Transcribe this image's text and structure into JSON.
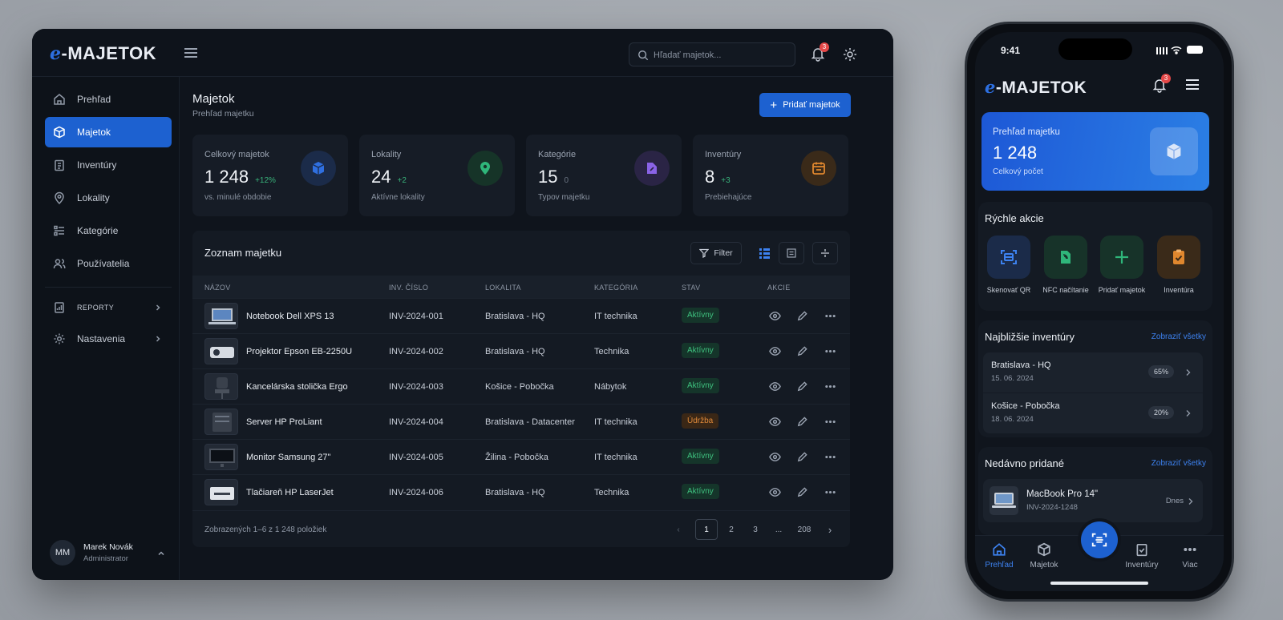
{
  "app": {
    "logo_e": "e",
    "logo_text": "-MAJETOK"
  },
  "header": {
    "search_placeholder": "Hľadať majetok...",
    "notif_count": "3"
  },
  "sidebar": {
    "items": [
      {
        "label": "Prehľad",
        "icon": "home-icon"
      },
      {
        "label": "Majetok",
        "icon": "box-icon"
      },
      {
        "label": "Inventúry",
        "icon": "clipboard-icon"
      },
      {
        "label": "Lokality",
        "icon": "map-pin-icon"
      },
      {
        "label": "Kategórie",
        "icon": "list-icon"
      },
      {
        "label": "Používatelia",
        "icon": "users-icon"
      },
      {
        "label": "REPORTY",
        "icon": "report-icon"
      },
      {
        "label": "Nastavenia",
        "icon": "gear-icon"
      }
    ],
    "user": {
      "initials": "MM",
      "name": "Marek Novák",
      "role": "Administrator"
    }
  },
  "page": {
    "title": "Majetok",
    "subtitle": "Prehľad majetku",
    "add_button": "Pridať majetok"
  },
  "stats": [
    {
      "label": "Celkový majetok",
      "value": "1 248",
      "delta": "+12%",
      "sub": "vs. minulé obdobie",
      "icon": "box-icon",
      "color": "#2f6fe0"
    },
    {
      "label": "Lokality",
      "value": "24",
      "delta": "+2",
      "sub": "Aktívne lokality",
      "icon": "map-pin-icon",
      "color": "#2fb67a"
    },
    {
      "label": "Kategórie",
      "value": "15",
      "delta": "0",
      "sub": "Typov majetku",
      "icon": "tag-icon",
      "color": "#8a63e6"
    },
    {
      "label": "Inventúry",
      "value": "8",
      "delta": "+3",
      "sub": "Prebiehajúce",
      "icon": "calendar-icon",
      "color": "#e0872e"
    }
  ],
  "table": {
    "title": "Zoznam majetku",
    "filter_label": "Filter",
    "columns": [
      "NÁZOV",
      "INV. ČÍSLO",
      "LOKALITA",
      "KATEGÓRIA",
      "STAV",
      "AKCIE"
    ],
    "rows": [
      {
        "name": "Notebook Dell XPS 13",
        "inv": "INV-2024-001",
        "location": "Bratislava - HQ",
        "category": "IT technika",
        "status": "Aktívny",
        "status_type": "ok",
        "thumb": "laptop"
      },
      {
        "name": "Projektor Epson EB-2250U",
        "inv": "INV-2024-002",
        "location": "Bratislava - HQ",
        "category": "Technika",
        "status": "Aktívny",
        "status_type": "ok",
        "thumb": "projector"
      },
      {
        "name": "Kancelárska stolička Ergo",
        "inv": "INV-2024-003",
        "location": "Košice - Pobočka",
        "category": "Nábytok",
        "status": "Aktívny",
        "status_type": "ok",
        "thumb": "chair"
      },
      {
        "name": "Server HP ProLiant",
        "inv": "INV-2024-004",
        "location": "Bratislava - Datacenter",
        "category": "IT technika",
        "status": "Údržba",
        "status_type": "warn",
        "thumb": "server"
      },
      {
        "name": "Monitor Samsung 27\"",
        "inv": "INV-2024-005",
        "location": "Žilina - Pobočka",
        "category": "IT technika",
        "status": "Aktívny",
        "status_type": "ok",
        "thumb": "monitor"
      },
      {
        "name": "Tlačiareň HP LaserJet",
        "inv": "INV-2024-006",
        "location": "Bratislava - HQ",
        "category": "Technika",
        "status": "Aktívny",
        "status_type": "ok",
        "thumb": "printer"
      }
    ],
    "footer": "Zobrazených 1–6 z 1 248 položiek",
    "pages": [
      "1",
      "2",
      "3",
      "...",
      "208"
    ],
    "current_page": "1"
  },
  "phone": {
    "time": "9:41",
    "notif_count": "3",
    "hero": {
      "title": "Prehľad majetku",
      "value": "1 248",
      "sub": "Celkový počet"
    },
    "quick": {
      "title": "Rýchle akcie",
      "actions": [
        {
          "label": "Skenovať QR",
          "icon": "qr-scan-icon",
          "color": "#2f6fe0"
        },
        {
          "label": "NFC načítanie",
          "icon": "nfc-icon",
          "color": "#2fb67a"
        },
        {
          "label": "Pridať majetok",
          "icon": "plus-icon",
          "color": "#2fb67a"
        },
        {
          "label": "Inventúra",
          "icon": "clipboard-check-icon",
          "color": "#e0872e"
        }
      ]
    },
    "upcoming": {
      "title": "Najbližšie inventúry",
      "link": "Zobraziť všetky",
      "items": [
        {
          "name": "Bratislava - HQ",
          "date": "15. 06. 2024",
          "pct": "65%"
        },
        {
          "name": "Košice - Pobočka",
          "date": "18. 06. 2024",
          "pct": "20%"
        }
      ]
    },
    "recent": {
      "title": "Nedávno pridané",
      "link": "Zobraziť všetky",
      "item": {
        "name": "MacBook Pro 14\"",
        "inv": "INV-2024-1248",
        "when": "Dnes"
      }
    },
    "tabs": [
      {
        "label": "Prehľad",
        "icon": "home-icon"
      },
      {
        "label": "Majetok",
        "icon": "box-icon"
      },
      {
        "label": "Inventúry",
        "icon": "clipboard-icon"
      },
      {
        "label": "Viac",
        "icon": "more-icon"
      }
    ]
  }
}
